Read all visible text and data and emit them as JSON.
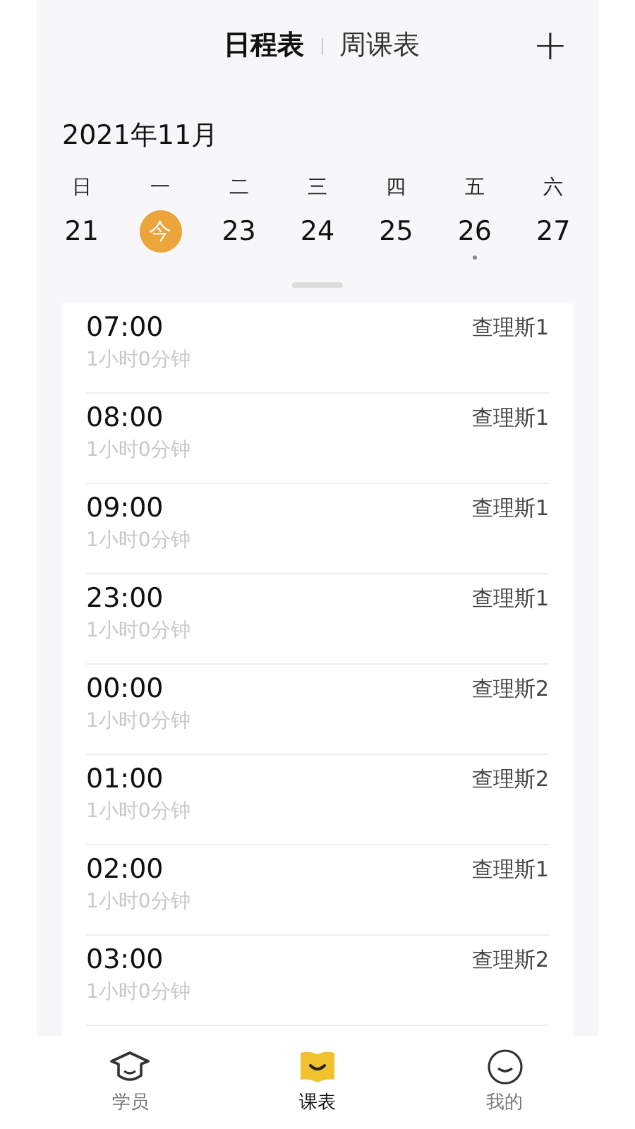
{
  "tabs": [
    {
      "label": "日程表",
      "selected": true
    },
    {
      "label": "周课表",
      "selected": false
    }
  ],
  "add_button": "+",
  "month": "2021年11月",
  "days": [
    {
      "weekday": "日",
      "date": "21",
      "selected": false,
      "has_event": false
    },
    {
      "weekday": "一",
      "date": "今",
      "selected": true,
      "has_event": false
    },
    {
      "weekday": "二",
      "date": "23",
      "selected": false,
      "has_event": false
    },
    {
      "weekday": "三",
      "date": "24",
      "selected": false,
      "has_event": false
    },
    {
      "weekday": "四",
      "date": "25",
      "selected": false,
      "has_event": false
    },
    {
      "weekday": "五",
      "date": "26",
      "selected": false,
      "has_event": true
    },
    {
      "weekday": "六",
      "date": "27",
      "selected": false,
      "has_event": false
    }
  ],
  "schedule": [
    {
      "time": "07:00",
      "duration": "1小时0分钟",
      "student": "查理斯1"
    },
    {
      "time": "08:00",
      "duration": "1小时0分钟",
      "student": "查理斯1"
    },
    {
      "time": "09:00",
      "duration": "1小时0分钟",
      "student": "查理斯1"
    },
    {
      "time": "23:00",
      "duration": "1小时0分钟",
      "student": "查理斯1"
    },
    {
      "time": "00:00",
      "duration": "1小时0分钟",
      "student": "查理斯2"
    },
    {
      "time": "01:00",
      "duration": "1小时0分钟",
      "student": "查理斯2"
    },
    {
      "time": "02:00",
      "duration": "1小时0分钟",
      "student": "查理斯1"
    },
    {
      "time": "03:00",
      "duration": "1小时0分钟",
      "student": "查理斯2"
    }
  ],
  "nav": [
    {
      "label": "学员",
      "kind": "students",
      "selected": false
    },
    {
      "label": "课表",
      "kind": "schedule",
      "selected": true
    },
    {
      "label": "我的",
      "kind": "profile",
      "selected": false
    }
  ]
}
